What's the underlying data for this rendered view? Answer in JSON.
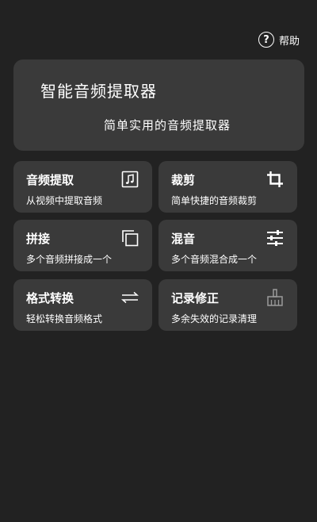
{
  "header": {
    "help_label": "帮助",
    "help_icon": "question-circle-icon"
  },
  "hero": {
    "title": "智能音频提取器",
    "subtitle": "简单实用的音频提取器"
  },
  "features": [
    {
      "title": "音频提取",
      "desc": "从视频中提取音频",
      "icon": "music-note-icon"
    },
    {
      "title": "裁剪",
      "desc": "简单快捷的音频裁剪",
      "icon": "crop-icon"
    },
    {
      "title": "拼接",
      "desc": "多个音频拼接成一个",
      "icon": "copy-icon"
    },
    {
      "title": "混音",
      "desc": "多个音频混合成一个",
      "icon": "sliders-icon"
    },
    {
      "title": "格式转换",
      "desc": "轻松转换音频格式",
      "icon": "swap-arrows-icon"
    },
    {
      "title": "记录修正",
      "desc": "多余失效的记录清理",
      "icon": "broom-icon"
    }
  ],
  "colors": {
    "background": "#222222",
    "card": "#3a3a3a",
    "text": "#ffffff",
    "icon_muted": "#9a9a9a"
  }
}
